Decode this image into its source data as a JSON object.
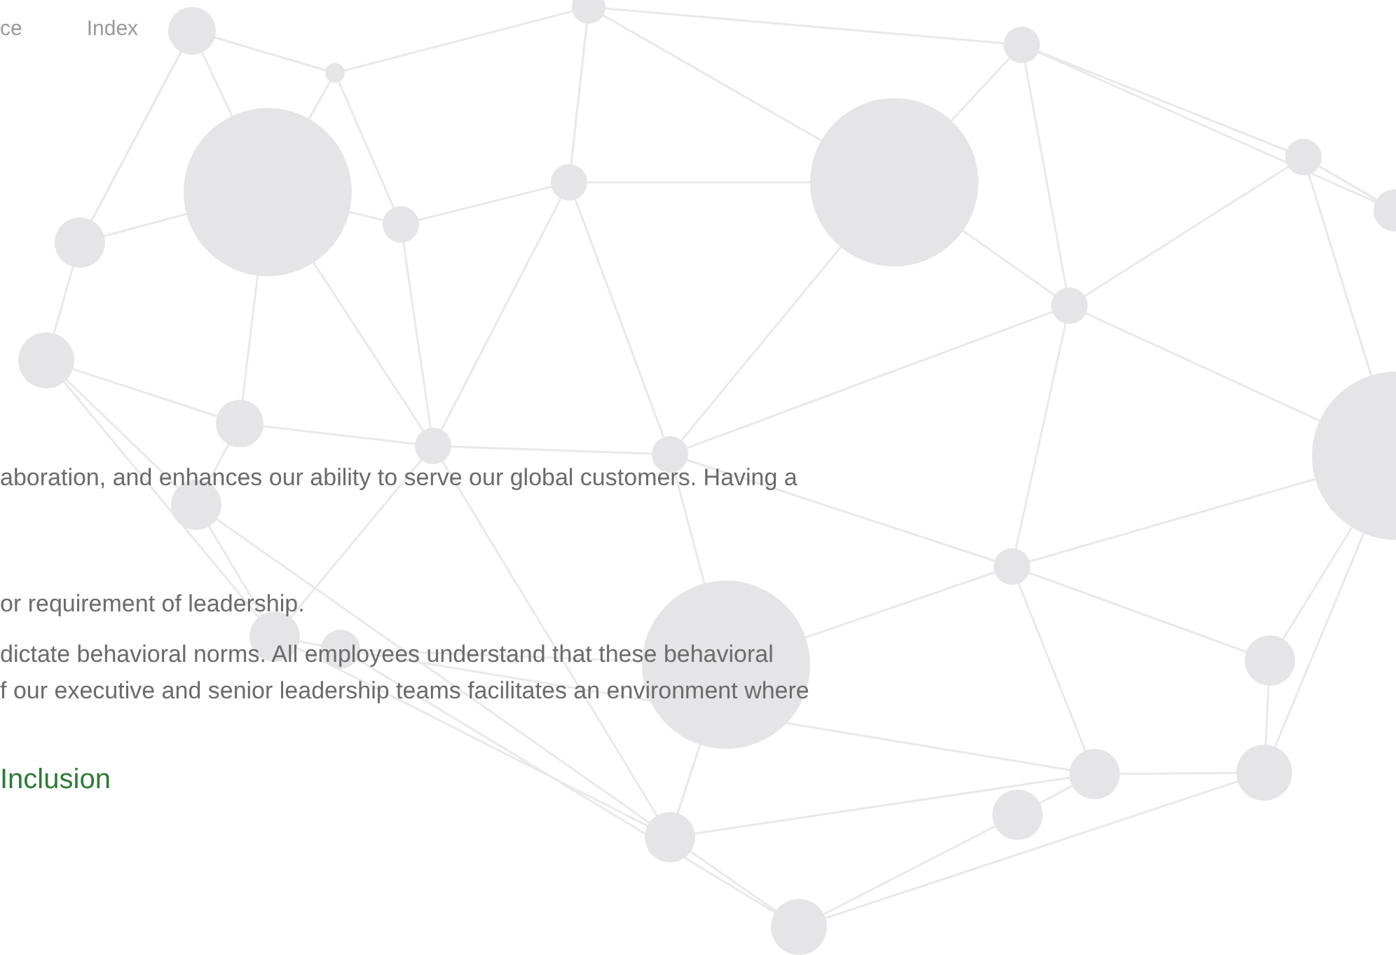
{
  "nav": [
    "ce",
    "Index"
  ],
  "paragraph_lines": [
    "aboration, and enhances our ability to serve our global customers. Having a",
    "or requirement of leadership.",
    "dictate behavioral norms. All employees understand that these behavioral",
    "f our executive and senior leadership teams facilitates an environment where"
  ],
  "heading": "Inclusion"
}
